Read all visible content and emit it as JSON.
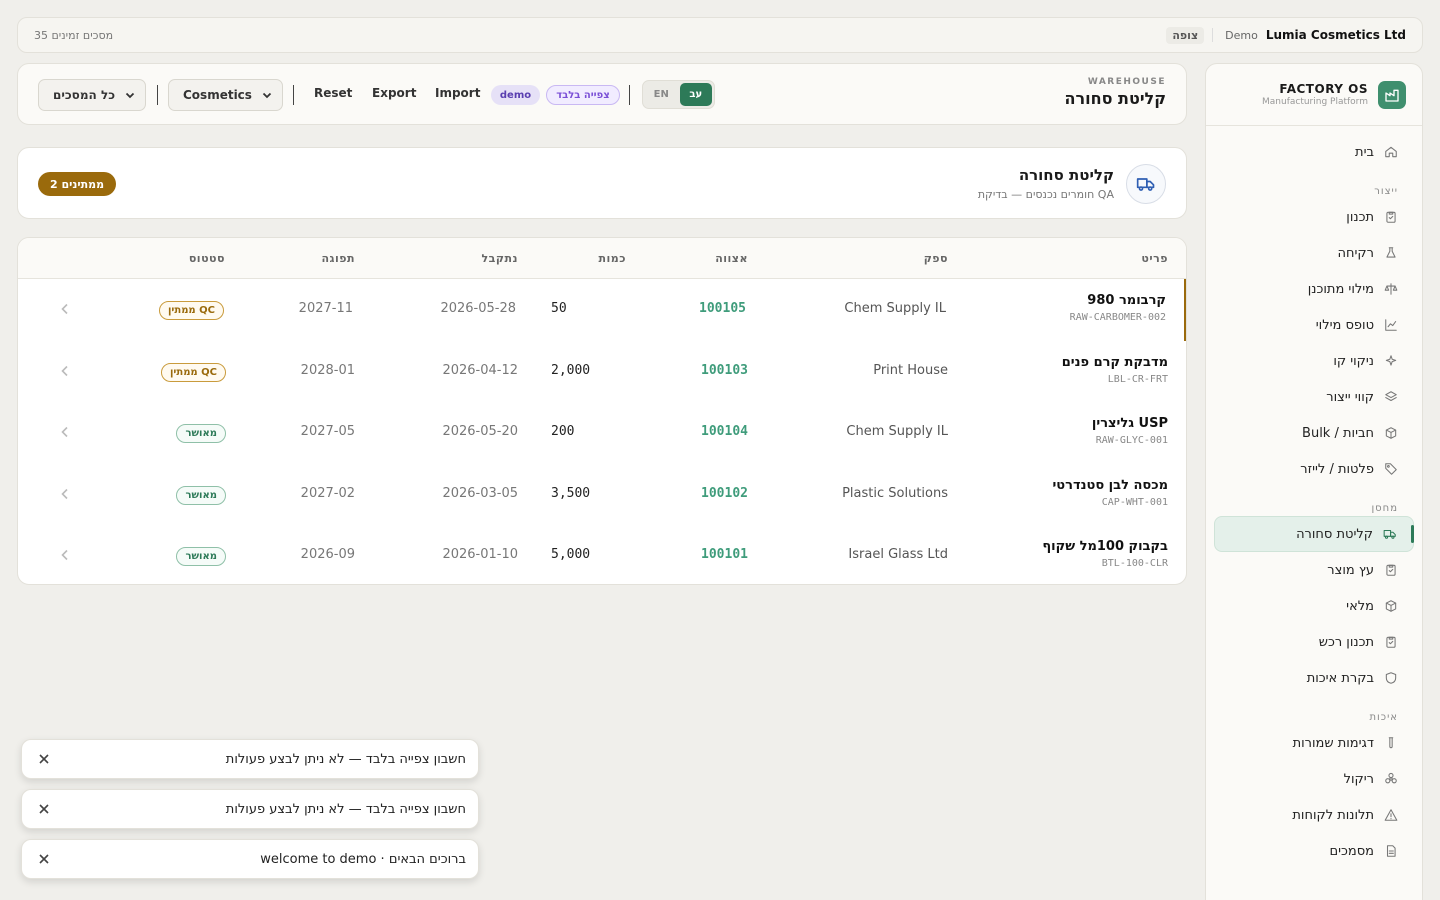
{
  "topbar": {
    "company": "Lumia Cosmetics Ltd",
    "env": "Demo",
    "view_badge": "צופה",
    "docs_count": "35 מסכים זמינים"
  },
  "sidebar": {
    "brand_name": "FACTORY OS",
    "brand_sub": "Manufacturing Platform",
    "home": {
      "label": "בית",
      "icon": "home-icon"
    },
    "sections": [
      {
        "title": "ייצור",
        "items": [
          {
            "label": "תכנון",
            "icon": "clipboard-icon"
          },
          {
            "label": "רקיחה",
            "icon": "flask-icon"
          },
          {
            "label": "מילוי מתוכנן",
            "icon": "scale-icon"
          },
          {
            "label": "טופס מילוי",
            "icon": "chart-icon"
          },
          {
            "label": "ניקוי קו",
            "icon": "sparkle-icon"
          },
          {
            "label": "קווי ייצור",
            "icon": "layers-icon"
          },
          {
            "label": "Bulk / חביות",
            "icon": "box-icon"
          },
          {
            "label": "פלטות / לייזר",
            "icon": "tag-icon"
          }
        ]
      },
      {
        "title": "מחסן",
        "items": [
          {
            "label": "קליטת סחורה",
            "icon": "truck-icon",
            "active": true
          },
          {
            "label": "עץ מוצר",
            "icon": "clipboard-icon"
          },
          {
            "label": "מלאי",
            "icon": "box-icon"
          },
          {
            "label": "תכנון רכש",
            "icon": "clipboard-icon"
          },
          {
            "label": "בקרת איכות",
            "icon": "shield-icon"
          }
        ]
      },
      {
        "title": "איכות",
        "items": [
          {
            "label": "דגימות שמורות",
            "icon": "tube-icon"
          },
          {
            "label": "ריקול",
            "icon": "biohazard-icon"
          },
          {
            "label": "תלונות לקוחות",
            "icon": "alert-icon"
          },
          {
            "label": "מסמכים",
            "icon": "document-icon"
          }
        ]
      }
    ]
  },
  "header": {
    "eyebrow": "WAREHOUSE",
    "title": "קליטת סחורה",
    "lang_en": "EN",
    "lang_he": "עב",
    "view_only": "צפייה בלבד",
    "demo": "demo",
    "import": "Import",
    "export": "Export",
    "reset": "Reset",
    "category": "Cosmetics",
    "screens": "כל המסכים"
  },
  "section": {
    "title": "קליטת סחורה",
    "subtitle": "חומרים נכנסים — בדיקת QA",
    "waiting": "2 ממתינים"
  },
  "table": {
    "columns": {
      "item": "פריט",
      "supplier": "ספק",
      "order": "אצווה",
      "qty": "כמות",
      "received": "נתקבל",
      "expiry": "תפוגה",
      "status": "סטטוס"
    },
    "rows": [
      {
        "name": "קרבומר 980",
        "sku": "RAW-CARBOMER-002",
        "supplier": "Chem Supply IL",
        "order": "100105",
        "qty": "50",
        "received": "2026-05-28",
        "expiry": "2027-11",
        "status": "ממתין QC",
        "status_type": "qc"
      },
      {
        "name": "מדבקת קרם פנים",
        "sku": "LBL-CR-FRT",
        "supplier": "Print House",
        "order": "100103",
        "qty": "2,000",
        "received": "2026-04-12",
        "expiry": "2028-01",
        "status": "ממתין QC",
        "status_type": "qc"
      },
      {
        "name": "גליצרין USP",
        "sku": "RAW-GLYC-001",
        "supplier": "Chem Supply IL",
        "order": "100104",
        "qty": "200",
        "received": "2026-05-20",
        "expiry": "2027-05",
        "status": "מאושר",
        "status_type": "ok"
      },
      {
        "name": "מכסה לבן סטנדרטי",
        "sku": "CAP-WHT-001",
        "supplier": "Plastic Solutions",
        "order": "100102",
        "qty": "3,500",
        "received": "2026-03-05",
        "expiry": "2027-02",
        "status": "מאושר",
        "status_type": "ok"
      },
      {
        "name": "בקבוק 100מל שקוף",
        "sku": "BTL-100-CLR",
        "supplier": "Israel Glass Ltd",
        "order": "100101",
        "qty": "5,000",
        "received": "2026-01-10",
        "expiry": "2026-09",
        "status": "מאושר",
        "status_type": "ok"
      }
    ]
  },
  "toasts": [
    {
      "message": "חשבון צפייה בלבד — לא ניתן לבצע פעולות"
    },
    {
      "message": "חשבון צפייה בלבד — לא ניתן לבצע פעולות"
    },
    {
      "message": "ברוכים הבאים · welcome to demo"
    }
  ]
}
